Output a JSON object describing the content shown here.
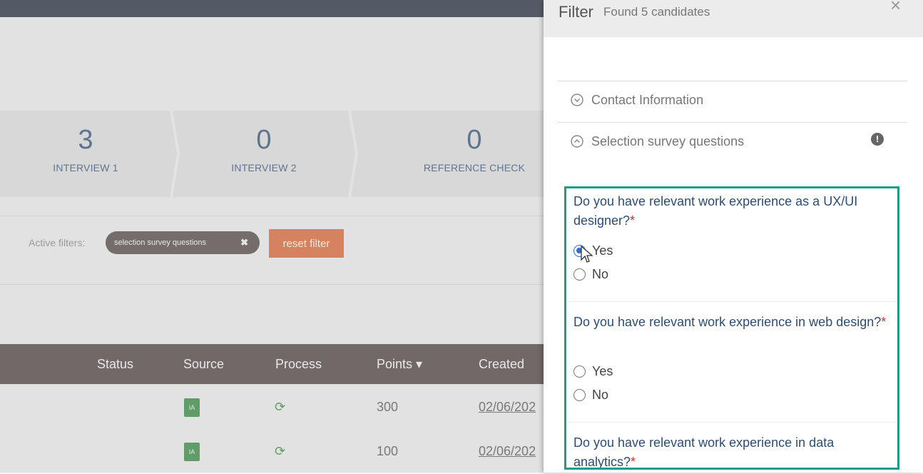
{
  "pipeline": [
    {
      "count": "3",
      "label": "INTERVIEW 1"
    },
    {
      "count": "0",
      "label": "INTERVIEW 2"
    },
    {
      "count": "0",
      "label": "REFERENCE CHECK"
    }
  ],
  "filters": {
    "active_label": "Active filters:",
    "chip_label": "selection survey questions",
    "reset_label": "reset filter"
  },
  "table": {
    "headers": [
      "Status",
      "Source",
      "Process",
      "Points ▾",
      "Created"
    ],
    "rows": [
      {
        "source_badge": "IA",
        "points": "300",
        "created": "02/06/202"
      },
      {
        "source_badge": "IA",
        "points": "100",
        "created": "02/06/202"
      }
    ]
  },
  "panel": {
    "title": "Filter",
    "count": "Found 5 candidates",
    "close": "×",
    "sections": {
      "contact": "Contact Information",
      "survey": "Selection survey questions"
    },
    "questions": [
      {
        "text": "Do you have relevant work experience as a UX/UI designer?",
        "required": "*",
        "options": [
          "Yes",
          "No"
        ],
        "selected": "Yes"
      },
      {
        "text": "Do you have relevant work experience in web design?",
        "required": "*",
        "options": [
          "Yes",
          "No"
        ],
        "selected": ""
      },
      {
        "text": "Do you have relevant work experience in data analytics?",
        "required": "*",
        "options": [],
        "selected": ""
      }
    ]
  },
  "colors": {
    "accent_teal": "#1a9d8a",
    "reset_orange": "#e5632c",
    "table_header": "#4a3b3b",
    "source_green": "#2f8b3a"
  }
}
